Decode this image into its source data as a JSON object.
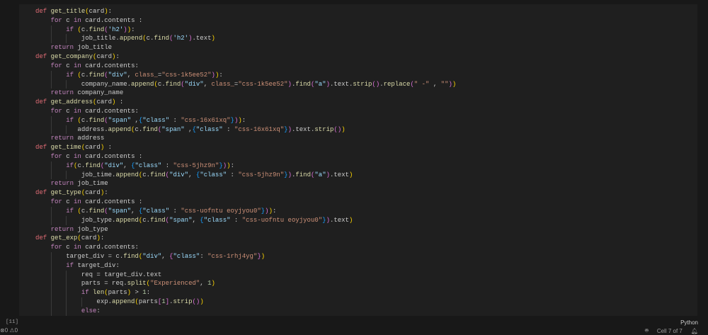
{
  "editor": {
    "language": "Python",
    "execution_count": "[11]",
    "code_lines": [
      "def get_title(card):",
      "    for c in card.contents :",
      "        if (c.find('h2')):",
      "            job_title.append(c.find('h2').text)",
      "    return job_title",
      "def get_company(card):",
      "    for c in card.contents:",
      "        if (c.find(\"div\", class_=\"css-1k5ee52\")):",
      "            company_name.append(c.find(\"div\", class_=\"css-1k5ee52\").find(\"a\").text.strip().replace(\" -\" , \"\"))",
      "    return company_name",
      "def get_address(card) :",
      "    for c in card.contents:",
      "        if (c.find(\"span\" ,{\"class\" : \"css-16x61xq\"})):",
      "           address.append(c.find(\"span\" ,{\"class\" : \"css-16x61xq\"}).text.strip())",
      "    return address",
      "def get_time(card) :",
      "    for c in card.contents :",
      "        if(c.find(\"div\", {\"class\" : \"css-5jhz9n\"})):",
      "            job_time.append(c.find(\"div\", {\"class\" : \"css-5jhz9n\"}).find(\"a\").text)",
      "    return job_time",
      "def get_type(card):",
      "    for c in card.contents :",
      "        if (c.find(\"span\", {\"class\" : \"css-uofntu eoyjyou0\"})):",
      "            job_type.append(c.find(\"span\", {\"class\" : \"css-uofntu eoyjyou0\"}).text)",
      "    return job_type",
      "def get_exp(card):",
      "    for c in card.contents:",
      "        target_div = c.find(\"div\", {\"class\": \"css-1rhj4yg\"})",
      "        if target_div:",
      "            req = target_div.text",
      "            parts = req.split(\"Experienced\", 1)",
      "            if len(parts) > 1:",
      "                exp.append(parts[1].strip())",
      "            else:"
    ]
  },
  "status_bar": {
    "errors": "0",
    "warnings": "0",
    "cell_position": "Cell 7 of 7"
  },
  "colors": {
    "background": "#1f1f1f",
    "keyword": "#c586c0",
    "function": "#dcdcaa",
    "string": "#ce9178"
  }
}
